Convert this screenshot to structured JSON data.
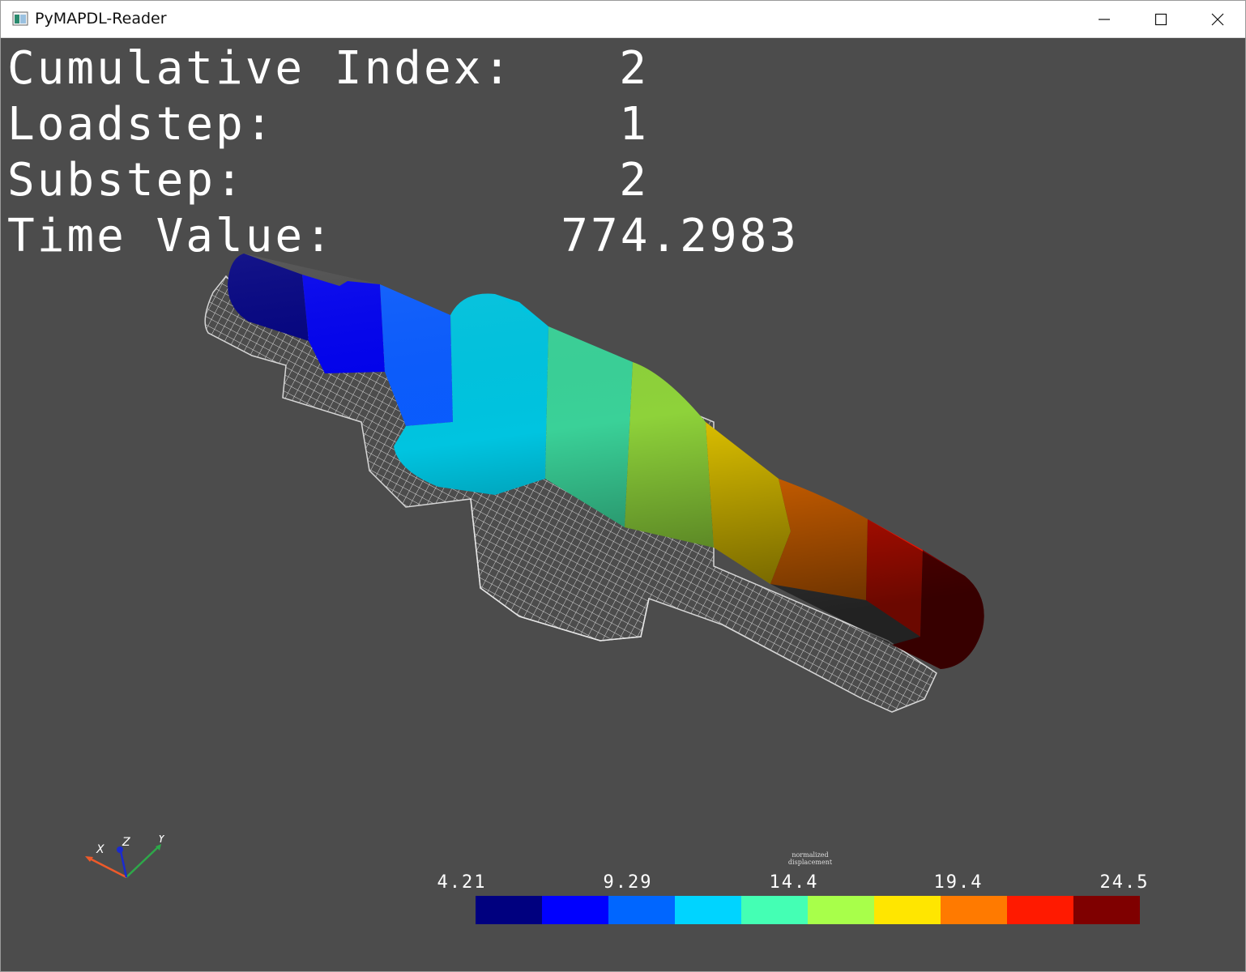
{
  "window": {
    "title": "PyMAPDL-Reader",
    "controls": {
      "minimize": "minimize-icon",
      "maximize": "maximize-icon",
      "close": "close-icon"
    }
  },
  "info": {
    "cumulative_index_label": "Cumulative Index:",
    "cumulative_index_value": "2",
    "loadstep_label": "Loadstep:",
    "loadstep_value": "1",
    "substep_label": "Substep:",
    "substep_value": "2",
    "time_value_label": "Time Value:",
    "time_value_value": "774.2983"
  },
  "axes": {
    "x": "X",
    "y": "Y",
    "z": "Z"
  },
  "scalar_bar": {
    "title_line1": "normalized",
    "title_line2": "displacement",
    "ticks": [
      "4.21",
      "9.29",
      "14.4",
      "19.4",
      "24.5"
    ],
    "colors": [
      "#00007f",
      "#0000ff",
      "#0066ff",
      "#00d4ff",
      "#44ffb4",
      "#a8ff4a",
      "#ffe600",
      "#ff7a00",
      "#ff1a00",
      "#7f0000"
    ]
  },
  "colors": {
    "background": "#4c4c4c",
    "text": "#ffffff",
    "wireframe": "#e6e6e6"
  }
}
